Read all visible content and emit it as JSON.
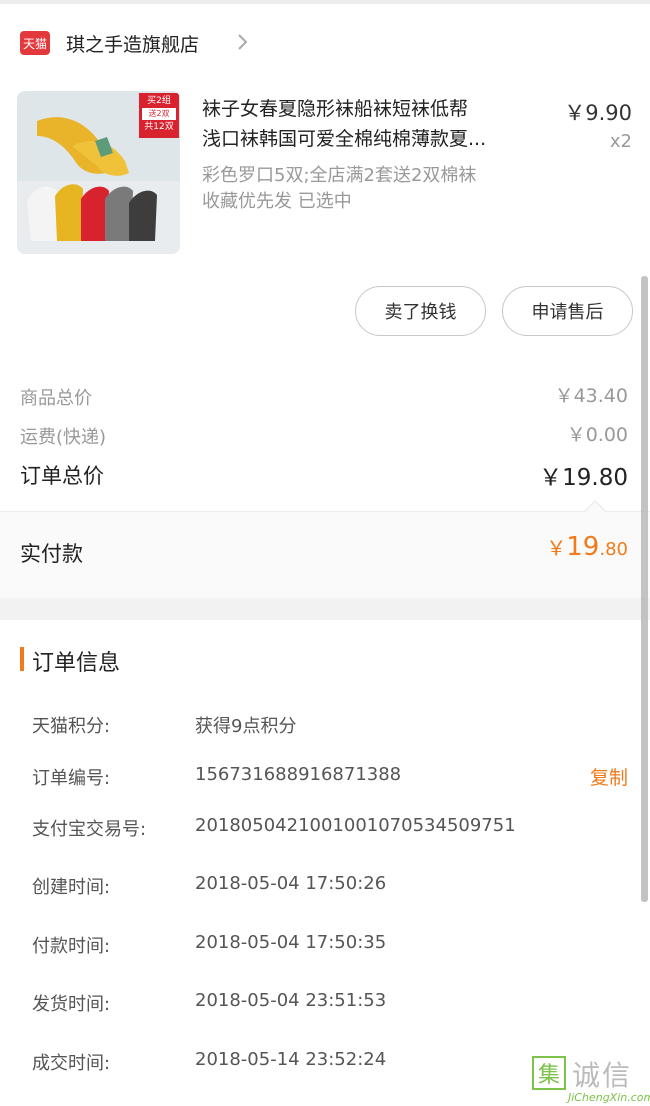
{
  "shop": {
    "badge": "天猫",
    "name": "琪之手造旗舰店"
  },
  "product": {
    "title_line1": "袜子女春夏隐形袜船袜短袜低帮",
    "title_line2": "浅口袜韩国可爱全棉纯棉薄款夏...",
    "price": "￥9.90",
    "qty": "x2",
    "sku_line1": "彩色罗口5双;全店满2套送2双棉袜",
    "sku_line2": "收藏优先发 已选中",
    "thumb_tag1": "买2组",
    "thumb_tag2": "送2双",
    "thumb_tag3": "共12双"
  },
  "actions": {
    "sell_label": "卖了换钱",
    "after_sale_label": "申请售后"
  },
  "summary": {
    "goods_total_label": "商品总价",
    "goods_total_value": "￥43.40",
    "shipping_label": "运费(快递)",
    "shipping_value": "￥0.00",
    "order_total_label": "订单总价",
    "order_total_value": "￥19.80",
    "paid_label": "实付款",
    "paid_symbol": "￥",
    "paid_int": "19",
    "paid_dec": ".80"
  },
  "order_info": {
    "title": "订单信息",
    "rows": [
      {
        "label": "天猫积分:",
        "value": "获得9点积分"
      },
      {
        "label": "订单编号:",
        "value": "156731688916871388"
      },
      {
        "label": "支付宝交易号:",
        "value": "2018050421001001070534509751"
      },
      {
        "label": "创建时间:",
        "value": "2018-05-04 17:50:26"
      },
      {
        "label": "付款时间:",
        "value": "2018-05-04 17:50:35"
      },
      {
        "label": "发货时间:",
        "value": "2018-05-04 23:51:53"
      },
      {
        "label": "成交时间:",
        "value": "2018-05-14 23:52:24"
      }
    ],
    "copy_label": "复制"
  },
  "watermark": {
    "mark": "集",
    "text": "诚信",
    "sub": "JiChengXin.com"
  },
  "colors": {
    "accent": "#f07b1a",
    "tmall_red": "#e4393c"
  }
}
